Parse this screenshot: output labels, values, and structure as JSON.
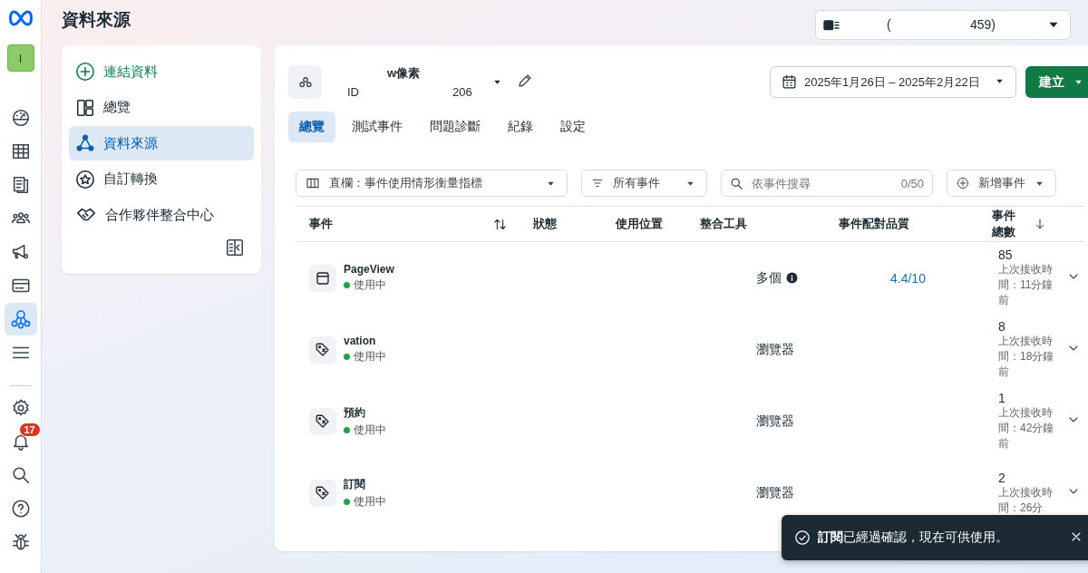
{
  "page_title": "資料來源",
  "account_selector": {
    "text_1": "(",
    "text_2": "459)"
  },
  "rail": {
    "avatar": "I",
    "items": [
      {
        "kind": "gauge",
        "selected": false
      },
      {
        "kind": "table",
        "selected": false
      },
      {
        "kind": "pages",
        "selected": false
      },
      {
        "kind": "people",
        "selected": false
      },
      {
        "kind": "megaphone",
        "selected": false
      },
      {
        "kind": "card",
        "selected": false
      },
      {
        "kind": "datasource",
        "selected": true
      },
      {
        "kind": "menu",
        "selected": false
      }
    ],
    "bottom_items": [
      {
        "kind": "gear"
      },
      {
        "kind": "bell",
        "badge": "17"
      },
      {
        "kind": "search"
      },
      {
        "kind": "help"
      },
      {
        "kind": "bug"
      }
    ]
  },
  "side_menu": {
    "items": [
      {
        "kind": "connect",
        "label": "連結資料",
        "selected": false
      },
      {
        "kind": "overview",
        "label": "總覽",
        "selected": false
      },
      {
        "kind": "datasource",
        "label": "資料來源",
        "selected": true
      },
      {
        "kind": "star",
        "label": "自訂轉換",
        "selected": false
      },
      {
        "kind": "handshake",
        "label": "合作夥伴整合中心",
        "selected": false
      }
    ]
  },
  "dataset": {
    "name": "w像素",
    "id_label": "ID",
    "id_value": "206"
  },
  "date_range": "2025年1月26日 – 2025年2月22日",
  "create_button": "建立",
  "tabs": [
    {
      "label": "總覽",
      "selected": true
    },
    {
      "label": "測試事件",
      "selected": false
    },
    {
      "label": "問題診斷",
      "selected": false
    },
    {
      "label": "紀錄",
      "selected": false
    },
    {
      "label": "設定",
      "selected": false
    }
  ],
  "filters": {
    "columns_dropdown": "直欄：事件使用情形衡量指標",
    "events_dropdown": "所有事件",
    "search": {
      "placeholder": "依事件搜尋",
      "counter": "0/50"
    },
    "add_event": "新增事件"
  },
  "table": {
    "columns": [
      "事件",
      "狀態",
      "使用位置",
      "整合工具",
      "事件配對品質",
      "事件總數"
    ],
    "rows": [
      {
        "kind": "window",
        "name": "PageView",
        "status": "使用中",
        "active": true,
        "integration": "多個",
        "integration_info": true,
        "quality": "4.4/10",
        "count": "85",
        "last_received": "上次接收時間：11分鐘前"
      },
      {
        "kind": "tag",
        "name": "vation",
        "status": "使用中",
        "active": true,
        "integration": "瀏覽器",
        "integration_info": false,
        "count": "8",
        "last_received": "上次接收時間：18分鐘前"
      },
      {
        "kind": "tag",
        "name": "預約",
        "status": "使用中",
        "active": true,
        "integration": "瀏覽器",
        "integration_info": false,
        "count": "1",
        "last_received": "上次接收時間：42分鐘前"
      },
      {
        "kind": "tag",
        "name": "訂閱",
        "status": "使用中",
        "active": true,
        "integration": "瀏覽器",
        "integration_info": false,
        "count": "2",
        "last_received": "上次接收時間：26分"
      }
    ]
  },
  "toast": {
    "message": "**訂閱**已經過確認，現在可供使用。"
  }
}
